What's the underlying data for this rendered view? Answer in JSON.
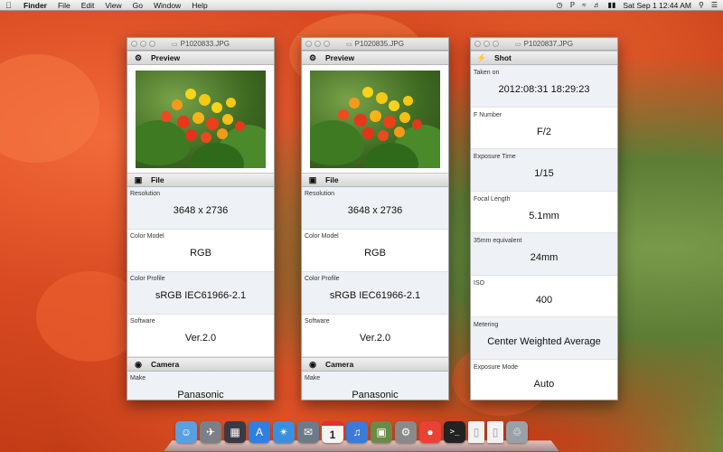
{
  "menubar": {
    "apple": "",
    "items": [
      "Finder",
      "File",
      "Edit",
      "View",
      "Go",
      "Window",
      "Help"
    ],
    "clock": "Sat Sep 1  12:44 AM"
  },
  "window1": {
    "title": "P1020833.JPG",
    "preview_label": "Preview",
    "file_label": "File",
    "camera_label": "Camera",
    "fields": [
      {
        "label": "Resolution",
        "value": "3648 x 2736"
      },
      {
        "label": "Color Model",
        "value": "RGB"
      },
      {
        "label": "Color Profile",
        "value": "sRGB IEC61966-2.1"
      },
      {
        "label": "Software",
        "value": "Ver.2.0"
      }
    ],
    "camera_fields": [
      {
        "label": "Make",
        "value": "Panasonic"
      }
    ]
  },
  "window2": {
    "title": "P1020835.JPG",
    "preview_label": "Preview",
    "file_label": "File",
    "camera_label": "Camera",
    "fields": [
      {
        "label": "Resolution",
        "value": "3648 x 2736"
      },
      {
        "label": "Color Model",
        "value": "RGB"
      },
      {
        "label": "Color Profile",
        "value": "sRGB IEC61966-2.1"
      },
      {
        "label": "Software",
        "value": "Ver.2.0"
      }
    ],
    "camera_fields": [
      {
        "label": "Make",
        "value": "Panasonic"
      }
    ]
  },
  "window3": {
    "title": "P1020837.JPG",
    "shot_label": "Shot",
    "fields": [
      {
        "label": "Taken on",
        "value": "2012:08:31 18:29:23"
      },
      {
        "label": "F Number",
        "value": "F/2"
      },
      {
        "label": "Exposure Time",
        "value": "1/15"
      },
      {
        "label": "Focal Length",
        "value": "5.1mm"
      },
      {
        "label": "35mm equivalent",
        "value": "24mm"
      },
      {
        "label": "ISO",
        "value": "400"
      },
      {
        "label": "Metering",
        "value": "Center Weighted Average"
      },
      {
        "label": "Exposure Mode",
        "value": "Auto"
      }
    ]
  },
  "dock": {
    "items": [
      {
        "name": "finder-icon",
        "color": "#5aa0e0"
      },
      {
        "name": "launchpad-icon",
        "color": "#7d7f86"
      },
      {
        "name": "mission-control-icon",
        "color": "#3a3a44"
      },
      {
        "name": "app-store-icon",
        "color": "#2f7fe0"
      },
      {
        "name": "safari-icon",
        "color": "#3b8fe0"
      },
      {
        "name": "mail-icon",
        "color": "#6d7a88"
      },
      {
        "name": "calendar-icon",
        "color": "#f4f4f4"
      },
      {
        "name": "itunes-icon",
        "color": "#3c7ad8"
      },
      {
        "name": "iphoto-icon",
        "color": "#6a8a4a"
      },
      {
        "name": "system-preferences-icon",
        "color": "#8a8a8a"
      },
      {
        "name": "chrome-icon",
        "color": "#e94235"
      },
      {
        "name": "terminal-icon",
        "color": "#222222"
      },
      {
        "name": "document-icon",
        "color": "#f2f2f2"
      },
      {
        "name": "document-icon",
        "color": "#f2f2f2"
      },
      {
        "name": "trash-icon",
        "color": "#9aa0a8"
      }
    ],
    "calendar_day": "1"
  }
}
